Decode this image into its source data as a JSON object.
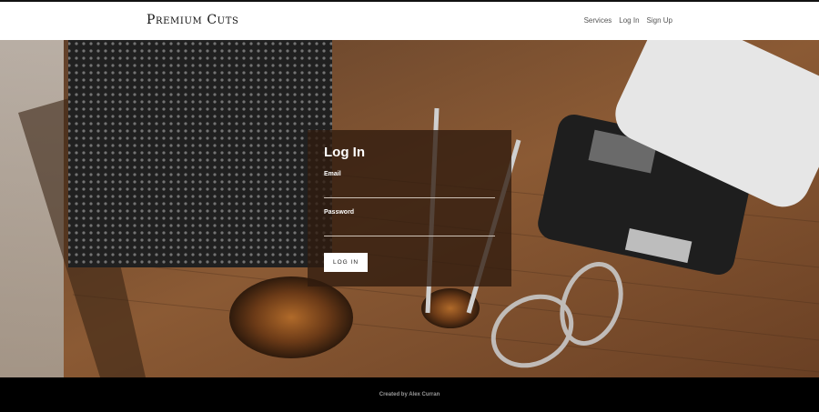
{
  "header": {
    "brand": "Premium Cuts",
    "nav": [
      "Services",
      "Log In",
      "Sign Up"
    ]
  },
  "login": {
    "title": "Log In",
    "email_label": "Email",
    "email_value": "",
    "password_label": "Password",
    "password_value": "",
    "submit_label": "LOG IN"
  },
  "footer": {
    "credit": "Created by Alex Curran"
  },
  "colors": {
    "navbar_bg": "#ffffff",
    "card_bg": "#301b0e",
    "footer_bg": "#000000"
  }
}
